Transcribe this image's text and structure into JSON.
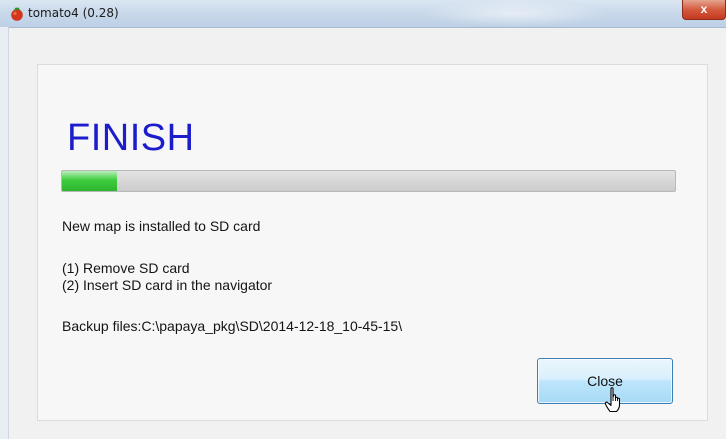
{
  "window": {
    "title": "tomato4 (0.28)",
    "close_symbol": "x",
    "app_icon": "tomato-icon"
  },
  "status": {
    "heading": "FINISH",
    "progress_fraction": 0.09,
    "progress_color": "#3fcd3f"
  },
  "messages": {
    "installed": "New map is installed to SD card",
    "step1": "(1) Remove SD card",
    "step2": "(2) Insert SD card in the navigator",
    "backup": "Backup files:C:\\papaya_pkg\\SD\\2014-12-18_10-45-15\\"
  },
  "buttons": {
    "close_label": "Close"
  },
  "colors": {
    "heading": "#1c1ccd",
    "button_border": "#3c7fb1"
  }
}
